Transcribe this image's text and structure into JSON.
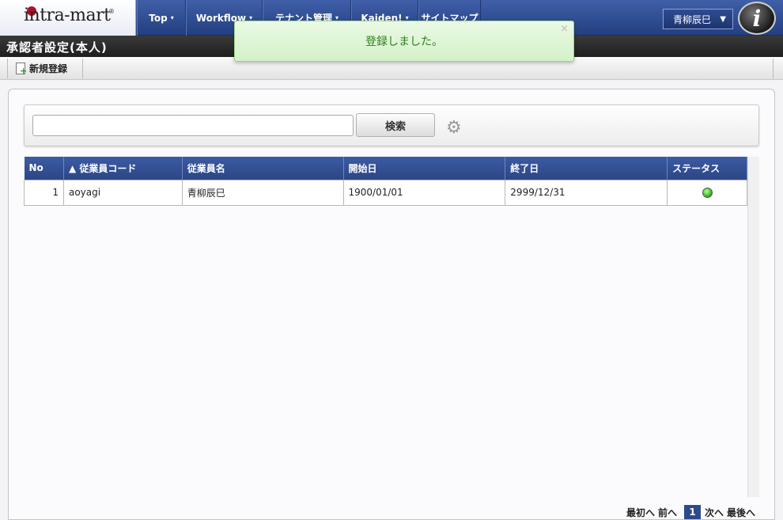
{
  "app": {
    "logo": "intra-mart",
    "logo_reg": "®"
  },
  "nav": {
    "items": [
      {
        "label": "Top",
        "caret": "▾"
      },
      {
        "label": "Workflow",
        "caret": "▾"
      },
      {
        "label": "テナント管理",
        "caret": "▾"
      },
      {
        "label": "Kaiden!",
        "caret": "▾"
      },
      {
        "label": "サイトマップ"
      }
    ],
    "user_name": "青柳辰巳",
    "user_caret": "▼",
    "info_icon_glyph": "i"
  },
  "page": {
    "title": "承認者設定(本人)"
  },
  "toolbar": {
    "new_label": "新規登録"
  },
  "search": {
    "input_value": "",
    "button_label": "検索",
    "settings_icon": "gear-icon"
  },
  "table": {
    "columns": [
      "No",
      "▲ 従業員コード",
      "従業員名",
      "開始日",
      "終了日",
      "ステータス"
    ],
    "rows": [
      {
        "no": "1",
        "code": "aoyagi",
        "name": "青柳辰巳",
        "start": "1900/01/01",
        "end": "2999/12/31",
        "status": "active"
      }
    ]
  },
  "pager": {
    "first": "最初へ",
    "prev": "前へ",
    "current": "1",
    "next": "次へ",
    "last": "最後へ"
  },
  "toast": {
    "message": "登録しました。",
    "close": "×"
  },
  "colors": {
    "nav_bg": "#2c4686",
    "header_bg": "#2c4686",
    "toast_bg": "#dff5d6",
    "status_ok": "#3cb82a"
  }
}
